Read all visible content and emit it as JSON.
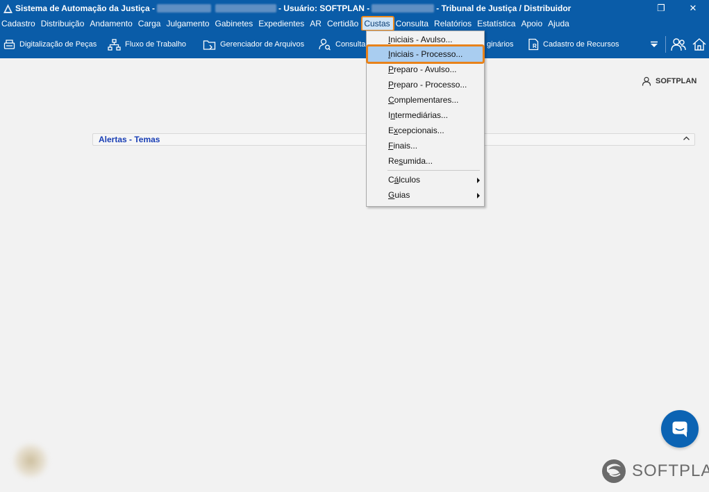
{
  "titlebar": {
    "app_name": "Sistema de Automação da Justiça -",
    "user": "- Usuário: SOFTPLAN -",
    "org": "- Tribunal de Justiça / Distribuidor",
    "restore_glyph": "❐",
    "close_glyph": "✕"
  },
  "menubar": {
    "items": [
      "Cadastro",
      "Distribuição",
      "Andamento",
      "Carga",
      "Julgamento",
      "Gabinetes",
      "Expedientes",
      "AR",
      "Certidão",
      "Custas",
      "Consulta",
      "Relatórios",
      "Estatística",
      "Apoio",
      "Ajuda"
    ],
    "active": "Custas"
  },
  "toolbar": {
    "items": [
      {
        "label": "Digitalização de Peças",
        "icon": "scanner-icon"
      },
      {
        "label": "Fluxo de Trabalho",
        "icon": "workflow-icon"
      },
      {
        "label": "Gerenciador de Arquivos",
        "icon": "folder-icon"
      },
      {
        "label": "Consulta",
        "icon": "user-search-icon"
      },
      {
        "label": "giná rios",
        "icon": ""
      },
      {
        "label": "Cadastro de Recursos",
        "icon": "resource-icon"
      }
    ],
    "partial_label": "ginários"
  },
  "user_badge": "SOFTPLAN",
  "panel": {
    "title": "Alertas - Temas"
  },
  "dropdown": {
    "items": [
      {
        "label": "Iniciais - Avulso...",
        "accel": "I"
      },
      {
        "label": "Iniciais - Processo...",
        "accel": "I",
        "selected": true
      },
      {
        "label": "Preparo - Avulso...",
        "accel": "P"
      },
      {
        "label": "Preparo - Processo...",
        "accel": "P"
      },
      {
        "label": "Complementares...",
        "accel": "C"
      },
      {
        "label": "Intermediárias...",
        "accel": "n"
      },
      {
        "label": "Excepcionais...",
        "accel": "x"
      },
      {
        "label": "Finais...",
        "accel": "F"
      },
      {
        "label": "Resumida...",
        "accel": "s"
      }
    ],
    "submenus": [
      {
        "label": "Cálculos",
        "accel": "á"
      },
      {
        "label": "Guias",
        "accel": "G"
      }
    ]
  },
  "logo": "SOFTPLAN",
  "colors": {
    "brand": "#0a5ca8",
    "highlight": "#a9cdf0",
    "focus_outline": "#e8821a",
    "panel_title": "#1a3fb5"
  }
}
